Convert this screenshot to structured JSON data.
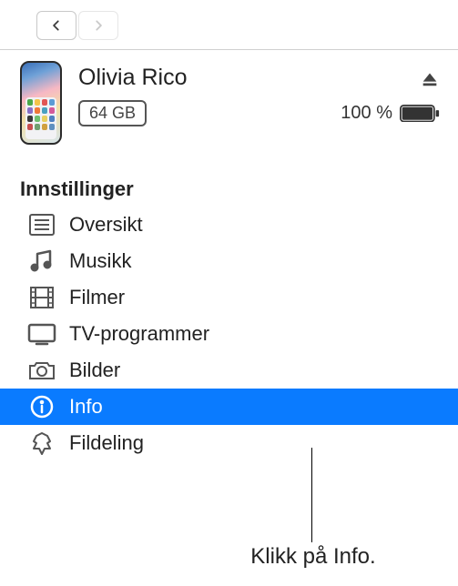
{
  "nav": {
    "back_icon": "chevron-left",
    "forward_icon": "chevron-right"
  },
  "device": {
    "name": "Olivia Rico",
    "storage": "64 GB",
    "battery_text": "100 %",
    "eject_icon": "eject"
  },
  "section_title": "Innstillinger",
  "sidebar": {
    "items": [
      {
        "label": "Oversikt",
        "icon": "list-icon",
        "selected": false
      },
      {
        "label": "Musikk",
        "icon": "music-icon",
        "selected": false
      },
      {
        "label": "Filmer",
        "icon": "film-icon",
        "selected": false
      },
      {
        "label": "TV-programmer",
        "icon": "tv-icon",
        "selected": false
      },
      {
        "label": "Bilder",
        "icon": "camera-icon",
        "selected": false
      },
      {
        "label": "Info",
        "icon": "info-icon",
        "selected": true
      },
      {
        "label": "Fildeling",
        "icon": "apps-icon",
        "selected": false
      }
    ]
  },
  "callout": "Klikk på Info.",
  "app_colors": [
    "#4aa84a",
    "#f2c44b",
    "#e25555",
    "#5a9bd5",
    "#8a6fc7",
    "#f07838",
    "#4aa0c0",
    "#d45a9a",
    "#3a3a3a",
    "#6fbf6f",
    "#e8d060",
    "#5080c0",
    "#c85050",
    "#70a070",
    "#d0a040",
    "#6090c0"
  ]
}
